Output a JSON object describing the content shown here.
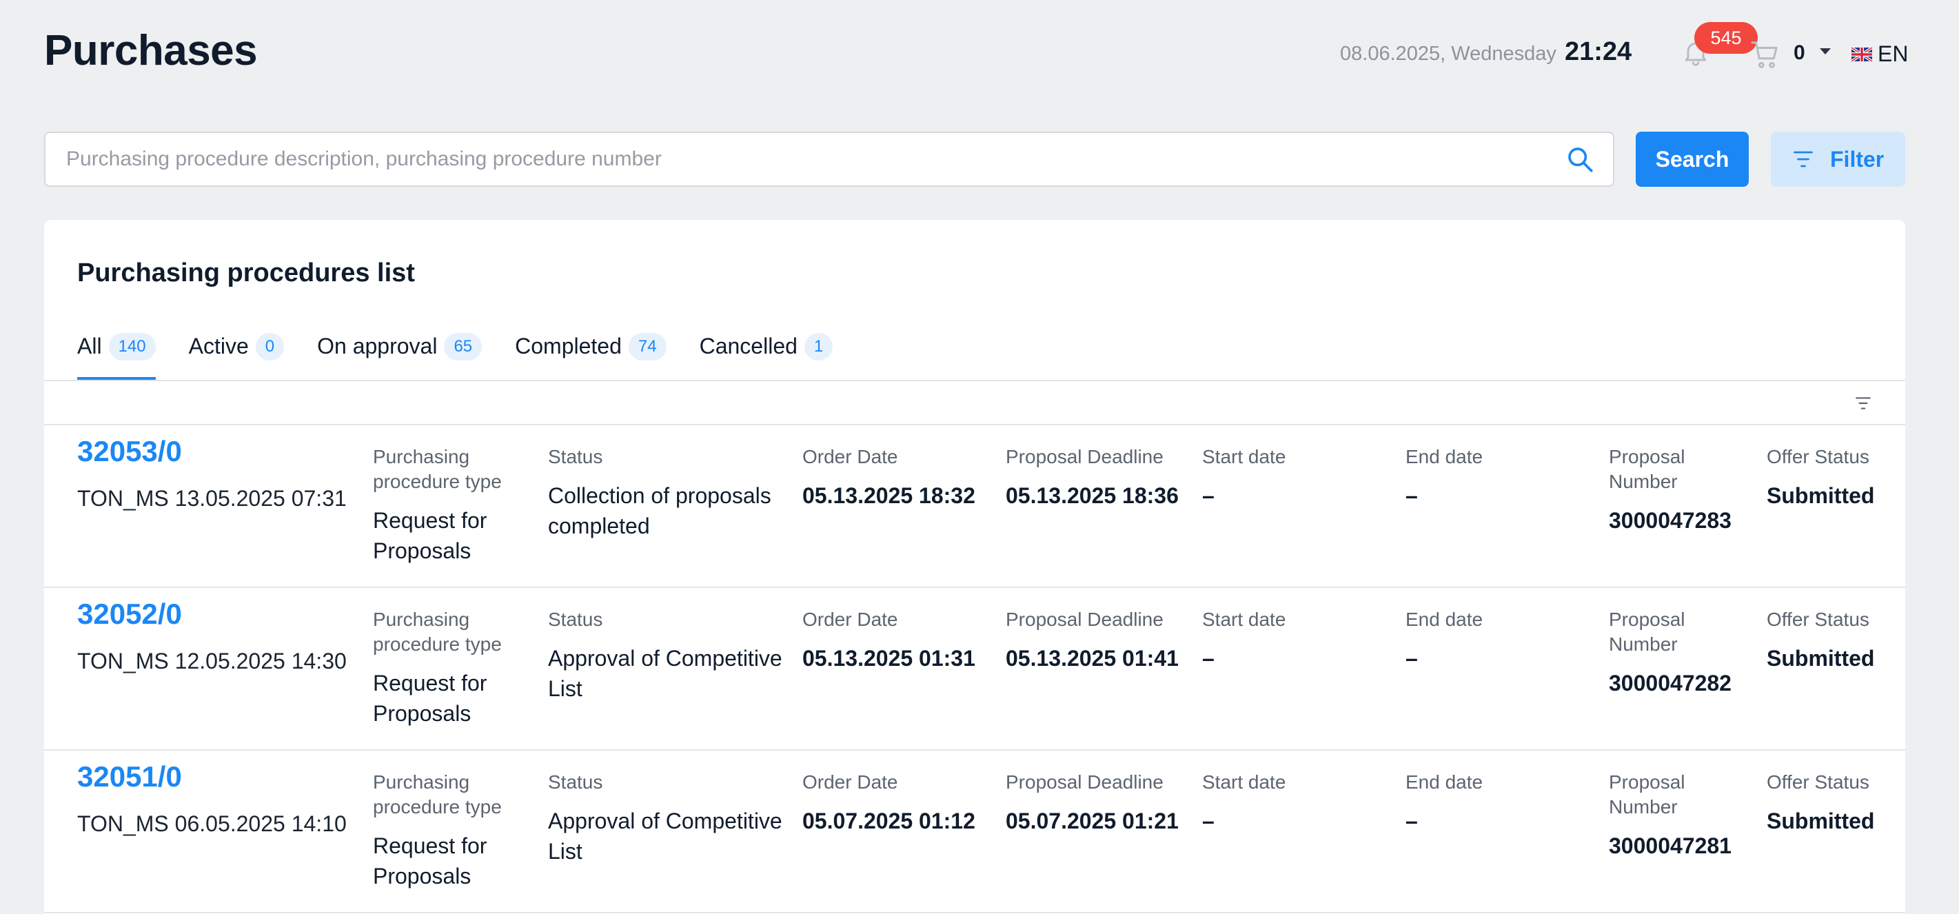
{
  "header": {
    "title": "Purchases",
    "date": "08.06.2025, Wednesday",
    "time": "21:24",
    "notifications_count": "545",
    "cart_count": "0",
    "language": "EN"
  },
  "search": {
    "placeholder": "Purchasing procedure description, purchasing procedure number",
    "value": "",
    "button_label": "Search",
    "filter_label": "Filter"
  },
  "list": {
    "title": "Purchasing procedures list",
    "tabs": [
      {
        "label": "All",
        "count": "140",
        "active": true
      },
      {
        "label": "Active",
        "count": "0",
        "active": false
      },
      {
        "label": "On approval",
        "count": "65",
        "active": false
      },
      {
        "label": "Completed",
        "count": "74",
        "active": false
      },
      {
        "label": "Cancelled",
        "count": "1",
        "active": false
      }
    ],
    "column_labels": {
      "type": "Purchasing procedure type",
      "status": "Status",
      "order_date": "Order Date",
      "deadline": "Proposal Deadline",
      "start": "Start date",
      "end": "End date",
      "proposal_number": "Proposal Number",
      "offer_status": "Offer Status"
    },
    "rows": [
      {
        "number": "32053/0",
        "author": "TON_MS 13.05.2025 07:31",
        "type": "Request for Proposals",
        "status": "Collection of proposals completed",
        "order_date": "05.13.2025 18:32",
        "deadline": "05.13.2025 18:36",
        "start": "–",
        "end": "–",
        "proposal_number": "3000047283",
        "offer_status": "Submitted"
      },
      {
        "number": "32052/0",
        "author": "TON_MS 12.05.2025 14:30",
        "type": "Request for Proposals",
        "status": "Approval of Competitive List",
        "order_date": "05.13.2025 01:31",
        "deadline": "05.13.2025 01:41",
        "start": "–",
        "end": "–",
        "proposal_number": "3000047282",
        "offer_status": "Submitted"
      },
      {
        "number": "32051/0",
        "author": "TON_MS 06.05.2025 14:10",
        "type": "Request for Proposals",
        "status": "Approval of Competitive List",
        "order_date": "05.07.2025 01:12",
        "deadline": "05.07.2025 01:21",
        "start": "–",
        "end": "–",
        "proposal_number": "3000047281",
        "offer_status": "Submitted"
      }
    ]
  },
  "icons": {
    "notifications": "bell-icon",
    "cart": "cart-icon",
    "language": "uk-flag-icon",
    "search": "search-icon",
    "filter": "filter-icon"
  },
  "colors": {
    "accent": "#1b87f5",
    "badge": "#f2463f",
    "background": "#eeeff1"
  }
}
